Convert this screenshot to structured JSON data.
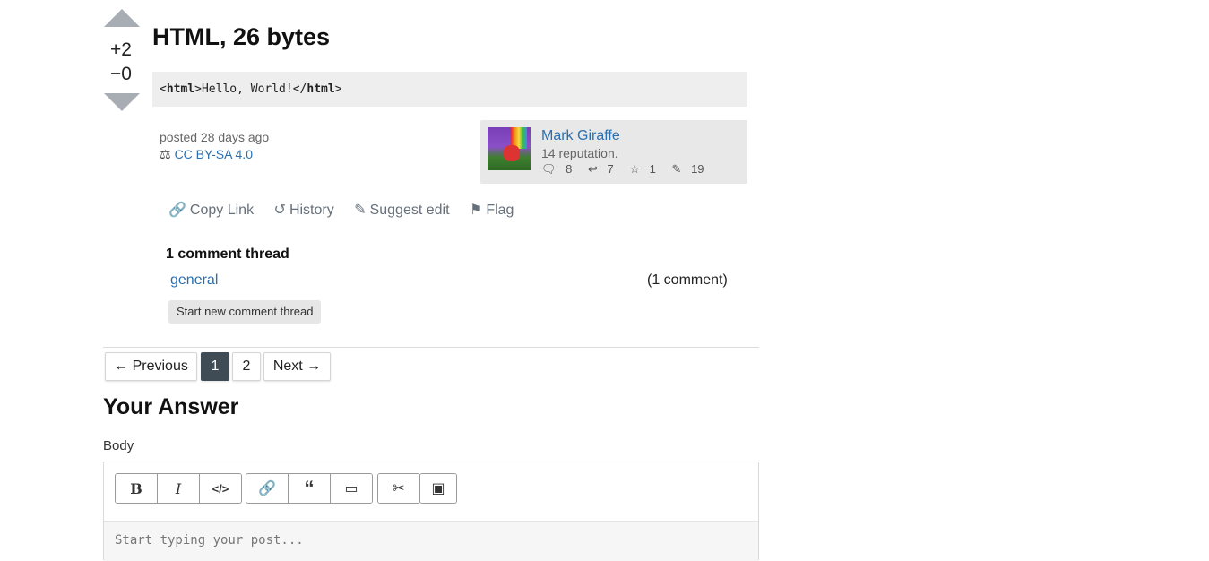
{
  "vote": {
    "up_count": "+2",
    "down_count": "−0"
  },
  "post": {
    "title": "HTML, 26 bytes",
    "code": {
      "open_tag": "html",
      "text": "Hello, World!",
      "close_tag": "html"
    },
    "posted": "posted 28 days ago",
    "license": "CC BY-SA 4.0"
  },
  "author": {
    "name": "Mark Giraffe",
    "reputation": "14 reputation.",
    "stats": {
      "comments": "8",
      "edits_suggested": "7",
      "stars": "1",
      "edits": "19"
    }
  },
  "actions": {
    "copy_link": "Copy Link",
    "history": "History",
    "suggest_edit": "Suggest edit",
    "flag": "Flag"
  },
  "comments": {
    "heading": "1 comment thread",
    "thread_name": "general",
    "thread_count": "(1 comment)",
    "new_thread_button": "Start new comment thread"
  },
  "pagination": {
    "previous": "← Previous",
    "pages": [
      "1",
      "2"
    ],
    "current": "1",
    "next": "Next →"
  },
  "answer": {
    "heading": "Your Answer",
    "body_label": "Body",
    "placeholder": "Start typing your post..."
  },
  "colors": {
    "accent": "#2a6fb0",
    "active_page": "#3f4c55",
    "vote_arrow": "#a7adb2"
  },
  "icons": [
    "bold-icon",
    "italic-icon",
    "code-icon",
    "link-icon",
    "quote-icon",
    "image-icon",
    "tools-icon",
    "save-icon"
  ]
}
